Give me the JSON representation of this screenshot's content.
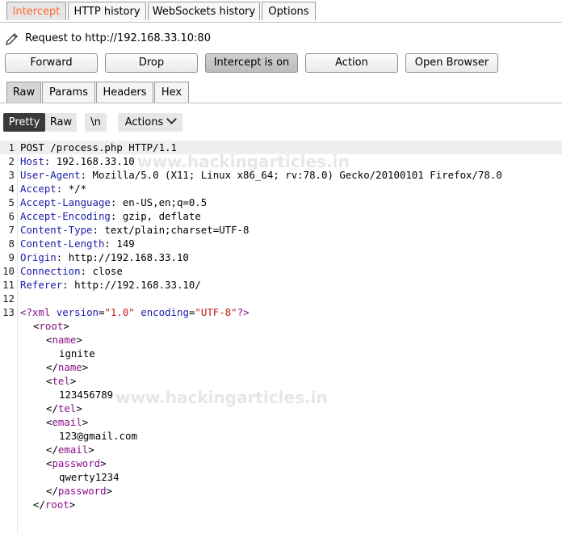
{
  "top_tabs": [
    "Intercept",
    "HTTP history",
    "WebSockets history",
    "Options"
  ],
  "request_info": "Request to http://192.168.33.10:80",
  "buttons": {
    "forward": "Forward",
    "drop": "Drop",
    "intercept": "Intercept is on",
    "action": "Action",
    "open_browser": "Open Browser"
  },
  "sub_tabs": [
    "Raw",
    "Params",
    "Headers",
    "Hex"
  ],
  "editor_toolbar": {
    "pretty": "Pretty",
    "raw": "Raw",
    "newline": "\\n",
    "actions": "Actions"
  },
  "watermark": "www.hackingarticles.in",
  "request": {
    "line_numbers": [
      "1",
      "2",
      "3",
      "4",
      "5",
      "6",
      "7",
      "8",
      "9",
      "10",
      "11",
      "12",
      "13"
    ],
    "request_line": "POST /process.php HTTP/1.1",
    "headers": [
      {
        "name": "Host",
        "value": "192.168.33.10"
      },
      {
        "name": "User-Agent",
        "value": "Mozilla/5.0 (X11; Linux x86_64; rv:78.0) Gecko/20100101 Firefox/78.0"
      },
      {
        "name": "Accept",
        "value": "*/*"
      },
      {
        "name": "Accept-Language",
        "value": "en-US,en;q=0.5"
      },
      {
        "name": "Accept-Encoding",
        "value": "gzip, deflate"
      },
      {
        "name": "Content-Type",
        "value": "text/plain;charset=UTF-8"
      },
      {
        "name": "Content-Length",
        "value": "149"
      },
      {
        "name": "Origin",
        "value": "http://192.168.33.10"
      },
      {
        "name": "Connection",
        "value": "close"
      },
      {
        "name": "Referer",
        "value": "http://192.168.33.10/"
      }
    ],
    "xml_decl": {
      "open": "<?xml",
      "attr1": "version",
      "val1": "\"1.0\"",
      "attr2": "encoding",
      "val2": "\"UTF-8\"",
      "close": "?>"
    },
    "body_lines": [
      {
        "indent": 1,
        "kind": "open",
        "tag": "root"
      },
      {
        "indent": 2,
        "kind": "open",
        "tag": "name"
      },
      {
        "indent": 3,
        "kind": "text",
        "text": "ignite"
      },
      {
        "indent": 2,
        "kind": "close",
        "tag": "name"
      },
      {
        "indent": 2,
        "kind": "open",
        "tag": "tel"
      },
      {
        "indent": 3,
        "kind": "text",
        "text": "123456789"
      },
      {
        "indent": 2,
        "kind": "close",
        "tag": "tel"
      },
      {
        "indent": 2,
        "kind": "open",
        "tag": "email"
      },
      {
        "indent": 3,
        "kind": "text",
        "text": "123@gmail.com"
      },
      {
        "indent": 2,
        "kind": "close",
        "tag": "email"
      },
      {
        "indent": 2,
        "kind": "open",
        "tag": "password"
      },
      {
        "indent": 3,
        "kind": "text",
        "text": "qwerty1234"
      },
      {
        "indent": 2,
        "kind": "close",
        "tag": "password"
      },
      {
        "indent": 1,
        "kind": "close",
        "tag": "root"
      }
    ]
  }
}
